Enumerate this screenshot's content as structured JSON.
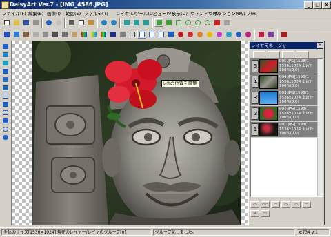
{
  "window": {
    "title": "DaisyArt Ver.7 - [IMG_4586.JPG]",
    "minimize": "_",
    "maximize": "□",
    "close": "×"
  },
  "menu": [
    "ファイル(F)",
    "編集(E)",
    "画像(I)",
    "範囲(S)",
    "フィルタ(T)",
    "レイヤ(L)",
    "ツール(U)",
    "ビュー(V)",
    "表示(D)",
    "ウィンドウ(W)",
    "オプション(O)",
    "ヘルプ(H)"
  ],
  "tooltip": "ﾚｲﾔの位置を調整",
  "layer_panel": {
    "title": "レイヤマネージャ",
    "close": "×",
    "layers": [
      {
        "num": "5",
        "line1": "005.JPG[1598/1",
        "line2": "1536x1024 上ﾚｲﾔｰ",
        "line3": "100%(0,0)",
        "thumb": "flower"
      },
      {
        "num": "4",
        "line1": "004.JPG[1598/1",
        "line2": "1536x1024 上ﾚｲﾔｰ",
        "line3": "100%(0,0)",
        "thumb": "statue"
      },
      {
        "num": "3",
        "line1": "003.JPG[1598/1",
        "line2": "1536x1024 上ﾚｲﾔｰ",
        "line3": "100%(0,0)",
        "thumb": "sky"
      },
      {
        "num": "2",
        "line1": "002.JPG[1598/1",
        "line2": "1536x1024 上ﾚｲﾔｰ",
        "line3": "100%(0,0)",
        "thumb": "redflower"
      },
      {
        "num": "1",
        "line1": "001.JPG[1598/1",
        "line2": "1536x1024 上ﾚｲﾔｰ",
        "line3": "100%(0,0)",
        "thumb": "dark"
      }
    ],
    "buttons": [
      "▭",
      "▭▭",
      "▭",
      "▭",
      "▭",
      "▭",
      "✂",
      "▭"
    ]
  },
  "status": {
    "left": "全体のサイズ[1536×1024] 現在のレイヤー/レイヤのグループ[0]",
    "middle": "グループ化しました。",
    "right": "x:734 y:1"
  },
  "colors": {
    "titlebar_start": "#0a246a",
    "titlebar_end": "#a6caf0",
    "chrome": "#d4d0c8",
    "layer_selected": "#808080"
  }
}
